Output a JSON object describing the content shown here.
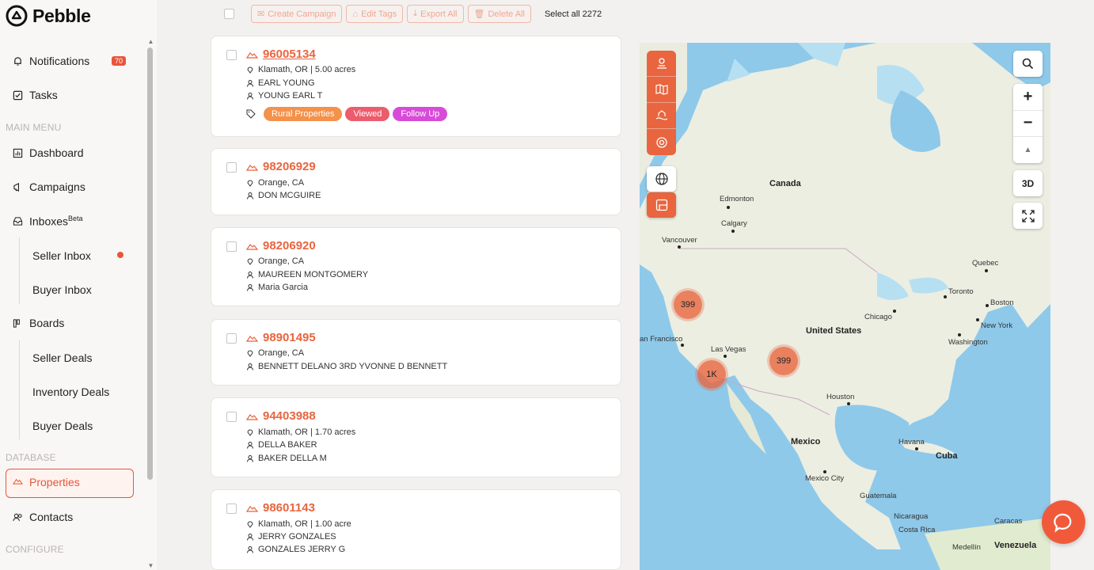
{
  "app": {
    "name": "Pebble"
  },
  "sidebar": {
    "notifications": {
      "label": "Notifications",
      "count": "70"
    },
    "tasks": "Tasks",
    "main_menu_label": "MAIN MENU",
    "dashboard": "Dashboard",
    "campaigns": "Campaigns",
    "inboxes": {
      "label": "Inboxes",
      "tag": "Beta"
    },
    "seller_inbox": "Seller Inbox",
    "buyer_inbox": "Buyer Inbox",
    "boards": "Boards",
    "seller_deals": "Seller Deals",
    "inventory_deals": "Inventory Deals",
    "buyer_deals": "Buyer Deals",
    "database_label": "DATABASE",
    "properties": "Properties",
    "contacts": "Contacts",
    "configure_label": "CONFIGURE"
  },
  "toolbar": {
    "create_campaign": "Create Campaign",
    "edit_tags": "Edit Tags",
    "export_all": "Export All",
    "delete_all": "Delete All",
    "select_all": "Select all 2272"
  },
  "properties": [
    {
      "id": "96005134",
      "location": "Klamath, OR | 5.00 acres",
      "owners": [
        "EARL YOUNG",
        "YOUNG EARL T"
      ],
      "tags": [
        "Rural Properties",
        "Viewed",
        "Follow Up"
      ]
    },
    {
      "id": "98206929",
      "location": "Orange, CA",
      "owners": [
        "DON MCGUIRE"
      ]
    },
    {
      "id": "98206920",
      "location": "Orange, CA",
      "owners": [
        "MAUREEN MONTGOMERY",
        "Maria Garcia"
      ]
    },
    {
      "id": "98901495",
      "location": "Orange, CA",
      "owners": [
        "BENNETT DELANO 3RD YVONNE D BENNETT"
      ]
    },
    {
      "id": "94403988",
      "location": "Klamath, OR | 1.70 acres",
      "owners": [
        "DELLA BAKER",
        "BAKER DELLA M"
      ]
    },
    {
      "id": "98601143",
      "location": "Klamath, OR | 1.00 acre",
      "owners": [
        "JERRY GONZALES",
        "GONZALES JERRY G"
      ]
    }
  ],
  "tag_colors": {
    "Rural Properties": "#f4914a",
    "Viewed": "#ec5c6c",
    "Follow Up": "#d84bd8"
  },
  "map": {
    "view_3d": "3D",
    "clusters": [
      "399",
      "1K",
      "399"
    ],
    "labels": {
      "canada": "Canada",
      "united_states": "United States",
      "mexico": "Mexico",
      "edmonton": "Edmonton",
      "calgary": "Calgary",
      "vancouver": "Vancouver",
      "quebec": "Quebec",
      "toronto": "Toronto",
      "boston": "Boston",
      "chicago": "Chicago",
      "new_york": "New York",
      "washington": "Washington",
      "san_francisco": "an Francisco",
      "las_vegas": "Las Vegas",
      "houston": "Houston",
      "havana": "Havana",
      "cuba": "Cuba",
      "mexico_city": "Mexico City",
      "guatemala": "Guatemala",
      "nicaragua": "Nicaragua",
      "costa_rica": "Costa Rica",
      "caracas": "Caracas",
      "medellin": "Medellín",
      "venezuela": "Venezuela"
    }
  },
  "accent": "#e8653f"
}
